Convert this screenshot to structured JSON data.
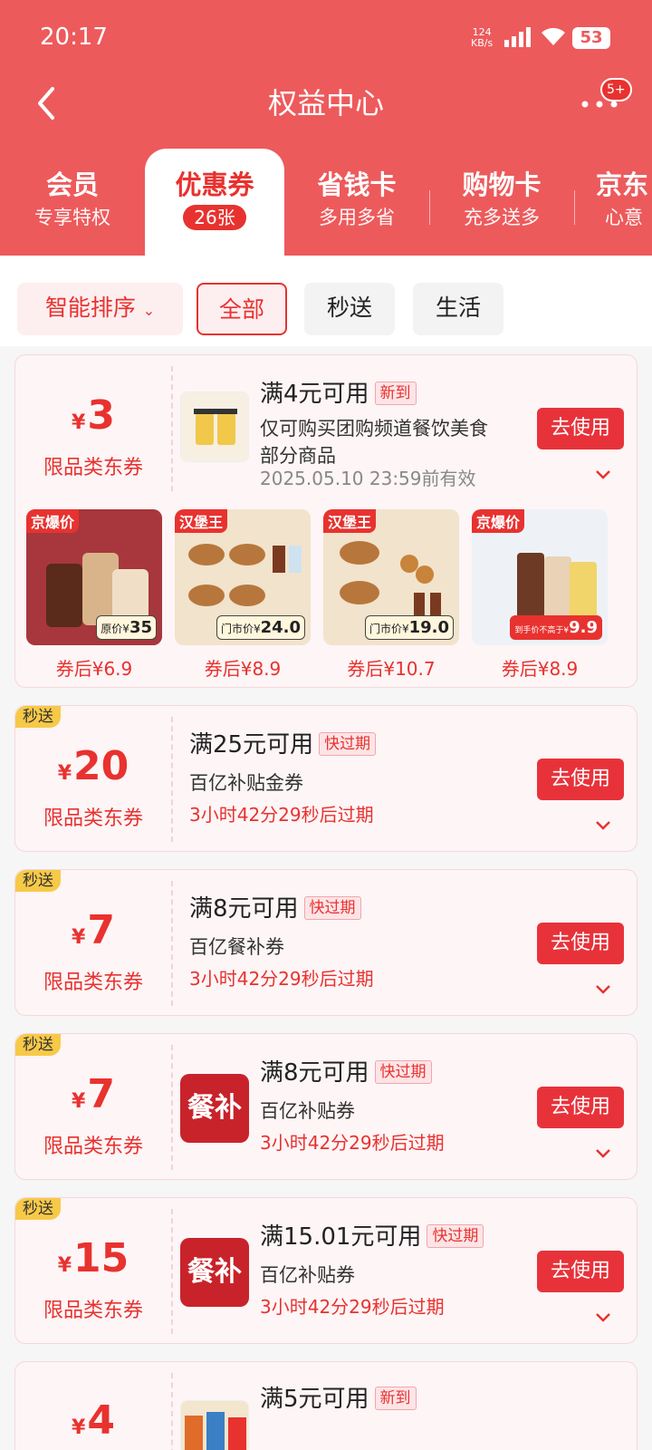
{
  "status": {
    "time": "20:17",
    "speed": "124",
    "speed_unit": "KB/s",
    "battery": "53"
  },
  "nav": {
    "title": "权益中心",
    "badge": "5+"
  },
  "tabs": [
    {
      "title": "会员",
      "sub": "专享特权"
    },
    {
      "title": "优惠券",
      "badge": "26张"
    },
    {
      "title": "省钱卡",
      "sub": "多用多省"
    },
    {
      "title": "购物卡",
      "sub": "充多送多"
    },
    {
      "title": "京东",
      "sub": "心意"
    }
  ],
  "filters": {
    "sort": "智能排序",
    "all": "全部",
    "speed": "秒送",
    "life": "生活"
  },
  "common": {
    "yen": "¥",
    "scope": "限品类东券",
    "use_btn": "去使用",
    "speed_tag": "秒送",
    "logo": "餐补"
  },
  "coupons": [
    {
      "amount": "3",
      "title": "满4元可用",
      "tag": "新到",
      "desc1": "仅可购买团购频道餐饮美食",
      "desc2": "部分商品",
      "expire": "2025.05.10 23:59前有效"
    },
    {
      "amount": "20",
      "title": "满25元可用",
      "tag": "快过期",
      "desc": "百亿补贴金券",
      "expire": "3小时42分29秒后过期"
    },
    {
      "amount": "7",
      "title": "满8元可用",
      "tag": "快过期",
      "desc": "百亿餐补券",
      "expire": "3小时42分29秒后过期"
    },
    {
      "amount": "7",
      "title": "满8元可用",
      "tag": "快过期",
      "desc": "百亿补贴券",
      "expire": "3小时42分29秒后过期"
    },
    {
      "amount": "15",
      "title": "满15.01元可用",
      "tag": "快过期",
      "desc": "百亿补贴券",
      "expire": "3小时42分29秒后过期"
    },
    {
      "amount": "4",
      "title": "满5元可用",
      "tag": "新到"
    }
  ],
  "products": [
    {
      "badge": "京爆价",
      "label": "原价¥",
      "value": "35",
      "price": "券后¥6.9"
    },
    {
      "badge": "汉堡王",
      "label": "门市价¥",
      "value": "24.0",
      "price": "券后¥8.9"
    },
    {
      "badge": "汉堡王",
      "label": "门市价¥",
      "value": "19.0",
      "price": "券后¥10.7"
    },
    {
      "badge": "京爆价",
      "label": "到手价不高于¥",
      "value": "9.9",
      "price": "券后¥8.9"
    }
  ],
  "colors": {
    "brand": "#ed5a5c",
    "accent": "#e8322f",
    "speed_tag": "#f7c948"
  }
}
